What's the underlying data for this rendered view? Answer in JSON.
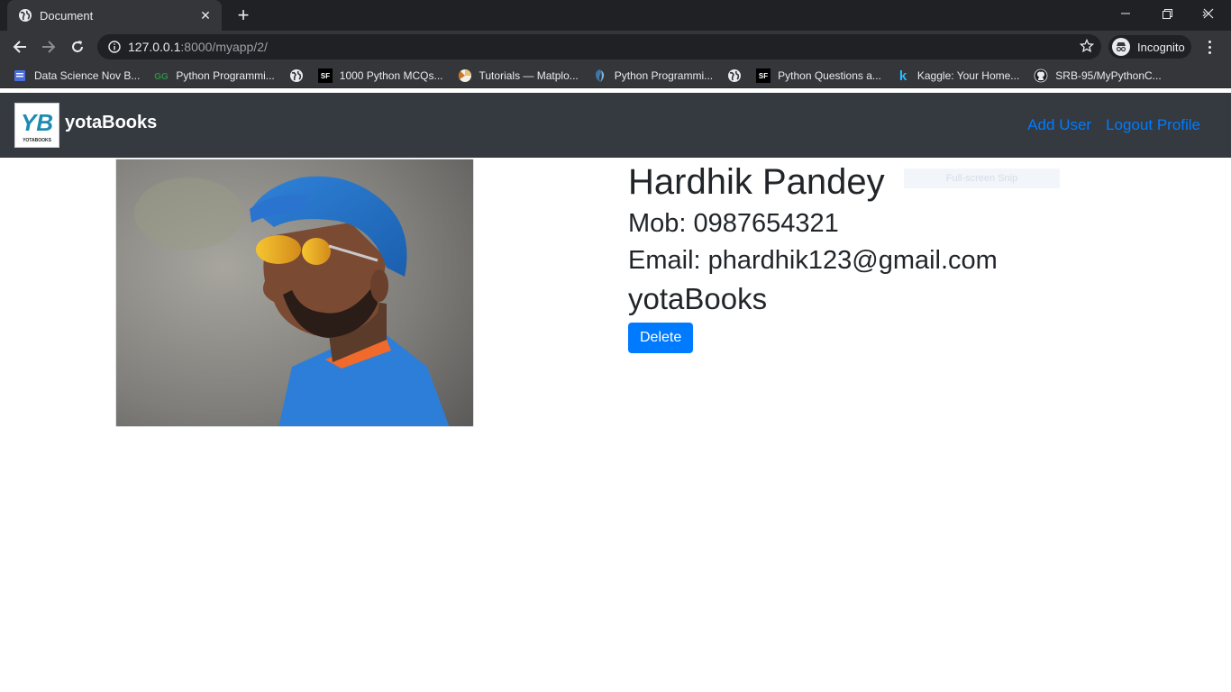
{
  "browser": {
    "tab": {
      "title": "Document",
      "icon": "globe-icon"
    },
    "url": {
      "host": "127.0.0.1",
      "path": ":8000/myapp/2/"
    },
    "profile_label": "Incognito",
    "bookmarks": [
      {
        "label": "Data Science Nov B...",
        "icon": "document-icon",
        "color": "#4a6ee0"
      },
      {
        "label": "Python Programmi...",
        "icon": "geeksforgeeks-icon",
        "color": "#2f8d46"
      },
      {
        "label": "",
        "icon": "globe-icon",
        "color": "#e8eaed"
      },
      {
        "label": "1000 Python MCQs...",
        "icon": "sanfoundry-icon",
        "color": "#000000"
      },
      {
        "label": "Tutorials — Matplo...",
        "icon": "matplotlib-icon",
        "color": "#e8c07a"
      },
      {
        "label": "Python Programmi...",
        "icon": "python-icon",
        "color": "#3b77a8"
      },
      {
        "label": "",
        "icon": "globe-icon",
        "color": "#e8eaed"
      },
      {
        "label": "Python Questions a...",
        "icon": "sanfoundry-icon",
        "color": "#000000"
      },
      {
        "label": "Kaggle: Your Home...",
        "icon": "kaggle-icon",
        "color": "#20beff"
      },
      {
        "label": "SRB-95/MyPythonC...",
        "icon": "github-icon",
        "color": "#e8eaed"
      }
    ]
  },
  "navbar": {
    "brand": "yotaBooks",
    "logo_text": "YB",
    "logo_subtext": "YOTABOOKS",
    "links": [
      "Add User",
      "Logout Profile"
    ]
  },
  "profile": {
    "name": "Hardhik Pandey",
    "mobile": "Mob: 0987654321",
    "email": "Email: phardhik123@gmail.com",
    "company": "yotaBooks",
    "delete_label": "Delete"
  },
  "overlay": {
    "snip_label": "Full-screen Snip"
  },
  "colors": {
    "accent": "#007bff",
    "navbar": "#343a40",
    "chrome": "#35363a"
  }
}
